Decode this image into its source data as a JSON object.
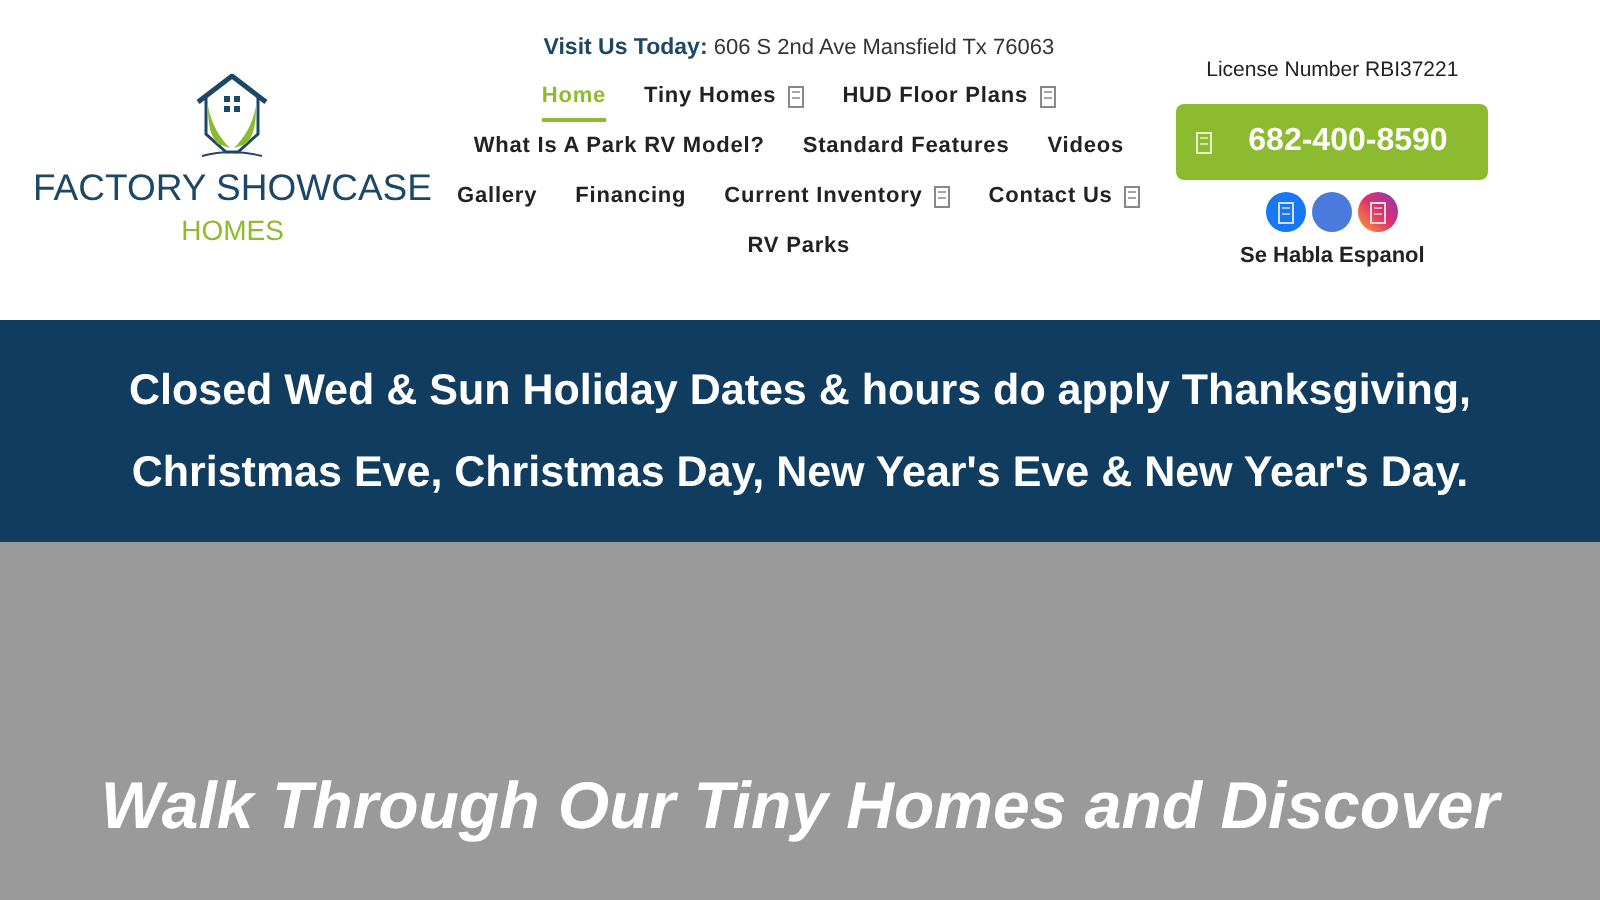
{
  "logo": {
    "title": "FACTORY SHOWCASE",
    "subtitle": "HOMES"
  },
  "visit": {
    "label": "Visit Us Today:",
    "address": "606 S 2nd Ave Mansfield Tx 76063"
  },
  "nav_rows": [
    [
      {
        "label": "Home",
        "selected": true,
        "dropdown": false
      },
      {
        "label": "Tiny Homes",
        "selected": false,
        "dropdown": true
      },
      {
        "label": "HUD Floor Plans",
        "selected": false,
        "dropdown": true
      }
    ],
    [
      {
        "label": "What Is A Park RV Model?",
        "selected": false,
        "dropdown": false
      },
      {
        "label": "Standard Features",
        "selected": false,
        "dropdown": false
      },
      {
        "label": "Videos",
        "selected": false,
        "dropdown": false
      }
    ],
    [
      {
        "label": "Gallery",
        "selected": false,
        "dropdown": false
      },
      {
        "label": "Financing",
        "selected": false,
        "dropdown": false
      },
      {
        "label": "Current Inventory",
        "selected": false,
        "dropdown": true
      },
      {
        "label": "Contact Us",
        "selected": false,
        "dropdown": true
      }
    ],
    [
      {
        "label": "RV Parks",
        "selected": false,
        "dropdown": false
      }
    ]
  ],
  "license": "License Number RBI37221",
  "phone": "682-400-8590",
  "social": [
    {
      "kind": "facebook"
    },
    {
      "kind": "plain"
    },
    {
      "kind": "instagram"
    }
  ],
  "spanish": "Se Habla Espanol",
  "notice": "Closed Wed & Sun Holiday Dates & hours do apply Thanksgiving, Christmas Eve, Christmas Day, New Year's Eve & New Year's Day.",
  "hero": {
    "heading": "Walk Through Our Tiny Homes and Discover"
  }
}
